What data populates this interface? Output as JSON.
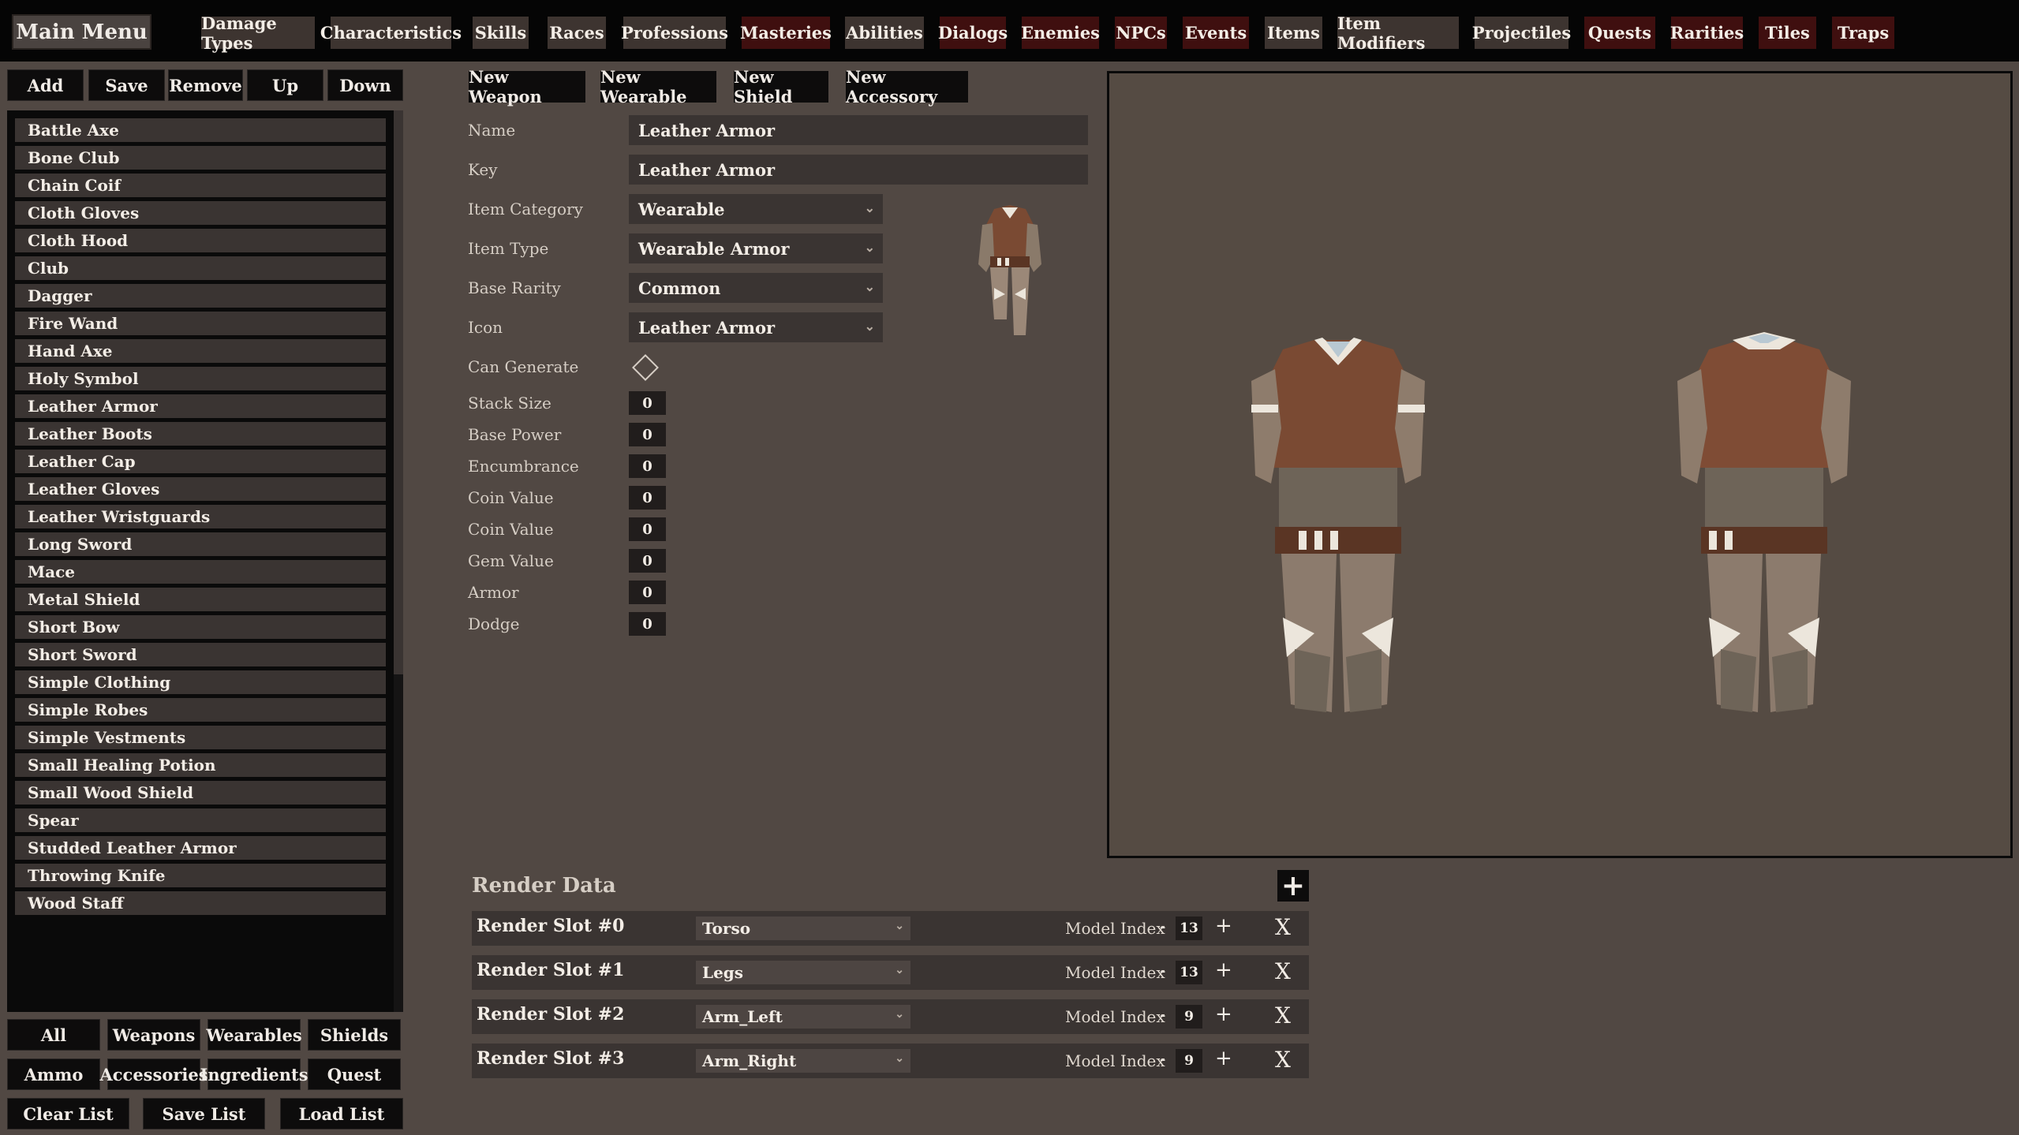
{
  "topbar": {
    "main_menu": "Main Menu",
    "tabs": [
      {
        "label": "Damage Types",
        "active": false
      },
      {
        "label": "Characteristics",
        "active": false
      },
      {
        "label": "Skills",
        "active": false
      },
      {
        "label": "Races",
        "active": false
      },
      {
        "label": "Professions",
        "active": false
      },
      {
        "label": "Masteries",
        "active": true
      },
      {
        "label": "Abilities",
        "active": false
      },
      {
        "label": "Dialogs",
        "active": true
      },
      {
        "label": "Enemies",
        "active": true
      },
      {
        "label": "NPCs",
        "active": true
      },
      {
        "label": "Events",
        "active": true
      },
      {
        "label": "Items",
        "active": false
      },
      {
        "label": "Item Modifiers",
        "active": false
      },
      {
        "label": "Projectiles",
        "active": false
      },
      {
        "label": "Quests",
        "active": true
      },
      {
        "label": "Rarities",
        "active": true
      },
      {
        "label": "Tiles",
        "active": true
      },
      {
        "label": "Traps",
        "active": true
      }
    ]
  },
  "left_toolbar": {
    "add": "Add",
    "save": "Save",
    "remove": "Remove",
    "up": "Up",
    "down": "Down"
  },
  "item_list": [
    "Battle Axe",
    "Bone Club",
    "Chain Coif",
    "Cloth Gloves",
    "Cloth Hood",
    "Club",
    "Dagger",
    "Fire Wand",
    "Hand Axe",
    "Holy Symbol",
    "Leather Armor",
    "Leather Boots",
    "Leather Cap",
    "Leather Gloves",
    "Leather Wristguards",
    "Long Sword",
    "Mace",
    "Metal Shield",
    "Short Bow",
    "Short Sword",
    "Simple Clothing",
    "Simple Robes",
    "Simple Vestments",
    "Small Healing Potion",
    "Small Wood Shield",
    "Spear",
    "Studded Leather Armor",
    "Throwing Knife",
    "Wood Staff"
  ],
  "filters": {
    "all": "All",
    "weapons": "Weapons",
    "wearables": "Wearables",
    "shields": "Shields",
    "ammo": "Ammo",
    "accessories": "Accessories",
    "ingredients": "Ingredients",
    "quest": "Quest",
    "clear_list": "Clear List",
    "save_list": "Save List",
    "load_list": "Load List"
  },
  "new_buttons": {
    "weapon": "New Weapon",
    "wearable": "New Wearable",
    "shield": "New Shield",
    "accessory": "New Accessory"
  },
  "form": {
    "name_label": "Name",
    "name_value": "Leather Armor",
    "key_label": "Key",
    "key_value": "Leather Armor",
    "category_label": "Item Category",
    "category_value": "Wearable",
    "type_label": "Item Type",
    "type_value": "Wearable Armor",
    "rarity_label": "Base Rarity",
    "rarity_value": "Common",
    "icon_label": "Icon",
    "icon_value": "Leather Armor",
    "can_generate_label": "Can Generate",
    "stack_size_label": "Stack Size",
    "stack_size": "0",
    "base_power_label": "Base Power",
    "base_power": "0",
    "encumbrance_label": "Encumbrance",
    "encumbrance": "0",
    "coin_value_label_1": "Coin Value",
    "coin_value_1": "0",
    "coin_value_label_2": "Coin Value",
    "coin_value_2": "0",
    "gem_value_label": "Gem Value",
    "gem_value": "0",
    "armor_label": "Armor",
    "armor": "0",
    "dodge_label": "Dodge",
    "dodge": "0"
  },
  "render_data": {
    "title": "Render Data",
    "model_index_label": "Model Index",
    "slots": [
      {
        "label": "Render Slot #0",
        "part": "Torso",
        "model_index": "13"
      },
      {
        "label": "Render Slot #1",
        "part": "Legs",
        "model_index": "13"
      },
      {
        "label": "Render Slot #2",
        "part": "Arm_Left",
        "model_index": "9"
      },
      {
        "label": "Render Slot #3",
        "part": "Arm_Right",
        "model_index": "9"
      }
    ]
  },
  "colors": {
    "background": "#514843",
    "topbar": "#050505",
    "tab_brown": "#3d3430",
    "tab_red": "#3f0f0f",
    "field": "#3a3432",
    "armor_leather": "#7a4a33",
    "armor_cloth": "#6e6458"
  }
}
